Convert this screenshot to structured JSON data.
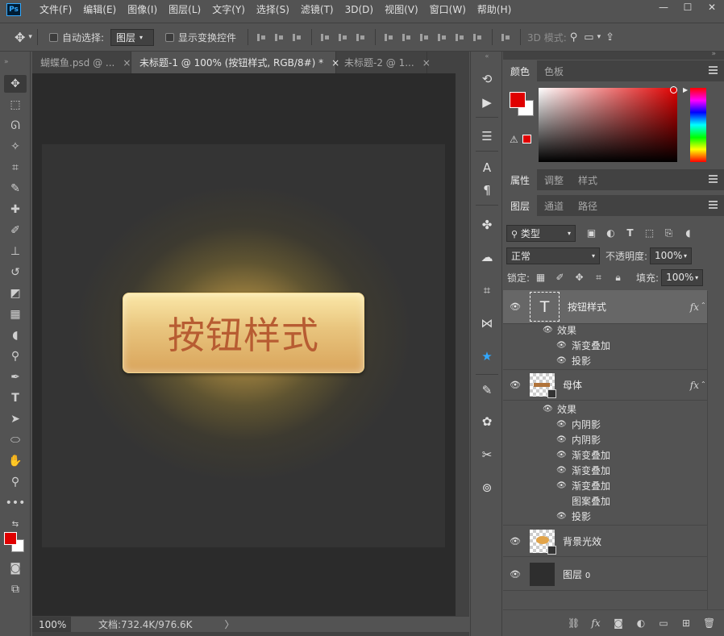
{
  "app": {
    "logo": "Ps",
    "menu": [
      "文件(F)",
      "编辑(E)",
      "图像(I)",
      "图层(L)",
      "文字(Y)",
      "选择(S)",
      "滤镜(T)",
      "3D(D)",
      "视图(V)",
      "窗口(W)",
      "帮助(H)"
    ],
    "window_controls": [
      "—",
      "☐",
      "✕"
    ]
  },
  "options": {
    "auto_select_label": "自动选择:",
    "auto_select_value": "图层",
    "show_transform_label": "显示变换控件",
    "mode_3d_label": "3D 模式:"
  },
  "tabs": [
    {
      "title": "蝴蝶鱼.psd @ ...",
      "close": "×"
    },
    {
      "title": "未标题-1 @ 100% (按钮样式, RGB/8#) *",
      "close": "×"
    },
    {
      "title": "未标题-2 @ 1...",
      "close": "×"
    }
  ],
  "canvas": {
    "button_text": "按钮样式"
  },
  "status": {
    "zoom": "100%",
    "doc_info": "文档:732.4K/976.6K",
    "arrow": "〉"
  },
  "color_panel": {
    "tabs": [
      "颜色",
      "色板"
    ],
    "foreground": "#e00000",
    "background": "#ffffff"
  },
  "properties_panel": {
    "tabs": [
      "属性",
      "调整",
      "样式"
    ]
  },
  "layers_panel": {
    "tabs": [
      "图层",
      "通道",
      "路径"
    ],
    "filter_kind": "类型",
    "blend_mode": "正常",
    "opacity_label": "不透明度:",
    "opacity_value": "100%",
    "lock_label": "锁定:",
    "fill_label": "填充:",
    "fill_value": "100%",
    "effects_label": "效果",
    "fx": "fx",
    "layers": [
      {
        "name": "按钮样式",
        "kind": "text",
        "effects": [
          "渐变叠加",
          "投影"
        ]
      },
      {
        "name": "母体",
        "kind": "shape",
        "effects": [
          "内阴影",
          "内阴影",
          "渐变叠加",
          "渐变叠加",
          "渐变叠加",
          "图案叠加",
          "投影"
        ]
      },
      {
        "name": "背景光效",
        "kind": "shape"
      },
      {
        "name": "图层",
        "kind": "pixel",
        "suffix": "0"
      }
    ]
  }
}
